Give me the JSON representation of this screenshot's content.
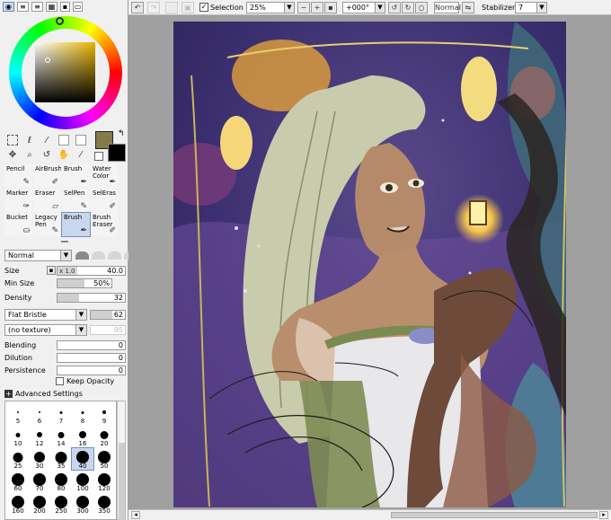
{
  "toolbar": {
    "selection_label": "Selection",
    "zoom_value": "25%",
    "rotation_value": "+000°",
    "blend_mode": "Normal",
    "stabilizer_label": "Stabilizer",
    "stabilizer_value": "7"
  },
  "color": {
    "foreground": "#857a4a",
    "background": "#000000",
    "panel_bg": "#f0f0f0",
    "selection_highlight": "#c8d7ee"
  },
  "brushes": [
    {
      "label": "Pencil",
      "icon": "pencil-icon"
    },
    {
      "label": "AirBrush",
      "icon": "airbrush-icon"
    },
    {
      "label": "Brush",
      "icon": "brush-icon"
    },
    {
      "label": "Water Color",
      "icon": "watercolor-icon"
    },
    {
      "label": "Marker",
      "icon": "marker-icon"
    },
    {
      "label": "Eraser",
      "icon": "eraser-icon"
    },
    {
      "label": "SelPen",
      "icon": "selpen-icon"
    },
    {
      "label": "SelEras",
      "icon": "seleras-icon"
    },
    {
      "label": "Bucket",
      "icon": "bucket-icon"
    },
    {
      "label": "Legacy Pen",
      "icon": "legacy-pen-icon"
    },
    {
      "label": "Brush",
      "icon": "brush-icon"
    },
    {
      "label": "Brush Eraser",
      "icon": "brush-eraser-icon"
    }
  ],
  "brush_settings": {
    "blend_mode": "Normal",
    "size_label": "Size",
    "size_multiplier": "x 1.0",
    "size_value": "40.0",
    "min_size_label": "Min Size",
    "min_size_value": "50%",
    "min_size_fraction": 0.5,
    "density_label": "Density",
    "density_value": "32",
    "density_fraction": 0.32,
    "texture_shape": "Flat Bristle",
    "texture_shape_value": "62",
    "texture": "(no texture)",
    "texture_value": "95",
    "blending_label": "Blending",
    "blending_value": "0",
    "dilution_label": "Dilution",
    "dilution_value": "0",
    "persistence_label": "Persistence",
    "persistence_value": "0",
    "keep_opacity_label": "Keep Opacity",
    "advanced_label": "Advanced Settings"
  },
  "size_palette": [
    "5",
    "6",
    "7",
    "8",
    "9",
    "10",
    "12",
    "14",
    "16",
    "20",
    "25",
    "30",
    "35",
    "40",
    "50",
    "60",
    "70",
    "80",
    "100",
    "120",
    "160",
    "200",
    "250",
    "300",
    "350"
  ],
  "size_palette_selected": "40"
}
